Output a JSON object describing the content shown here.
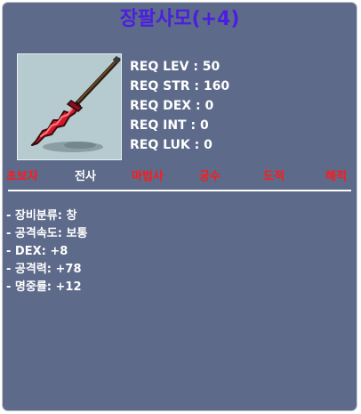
{
  "tooltip": {
    "title": "장팔사모(+4)",
    "title_color": "#4b1fe0",
    "panel_color": "#5d6a8a",
    "item_icon": "red-spear-icon",
    "requirements": [
      "REQ LEV : 50",
      "REQ STR : 160",
      "REQ DEX : 0",
      "REQ INT : 0",
      "REQ LUK : 0"
    ],
    "jobs": [
      {
        "label": "초보자",
        "color": "#ff1a1a",
        "allowed": false
      },
      {
        "label": "전사",
        "color": "#ffffff",
        "allowed": true
      },
      {
        "label": "마법사",
        "color": "#ff1a1a",
        "allowed": false
      },
      {
        "label": "궁수",
        "color": "#ff1a1a",
        "allowed": false
      },
      {
        "label": "도적",
        "color": "#ff1a1a",
        "allowed": false
      },
      {
        "label": "해적",
        "color": "#ff1a1a",
        "allowed": false
      }
    ],
    "stats": [
      "- 장비분류: 창",
      "- 공격속도: 보통",
      "- DEX: +8",
      "- 공격력: +78",
      "- 명중률: +12"
    ]
  }
}
